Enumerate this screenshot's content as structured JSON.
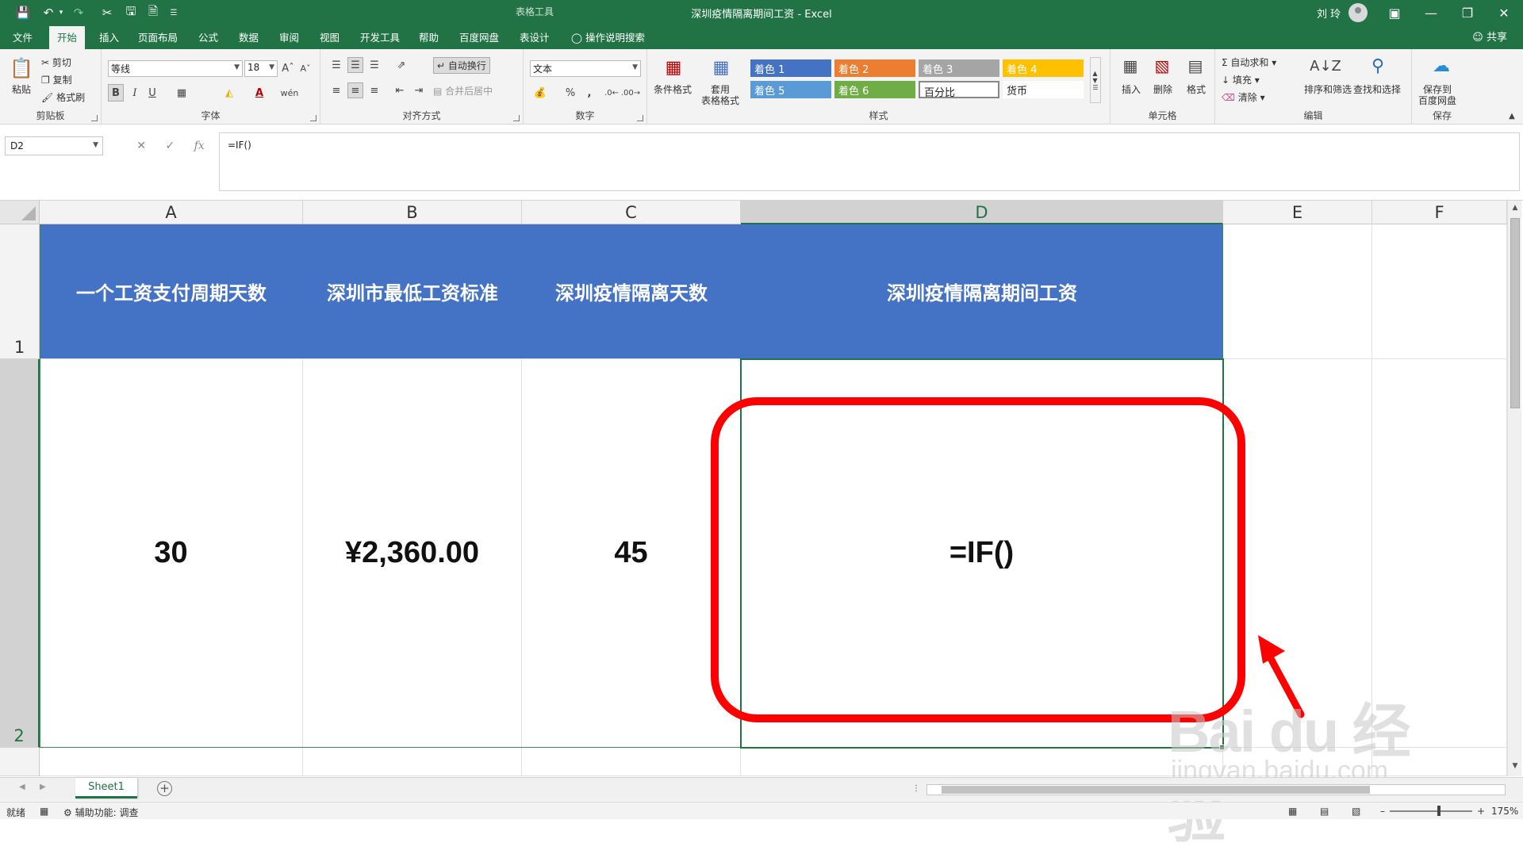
{
  "window": {
    "title": "深圳疫情隔离期间工资  -  Excel",
    "context_tool": "表格工具",
    "user_name": "刘 玲"
  },
  "tabs": [
    {
      "id": "file",
      "label": "文件"
    },
    {
      "id": "home",
      "label": "开始"
    },
    {
      "id": "insert",
      "label": "插入"
    },
    {
      "id": "page-layout",
      "label": "页面布局"
    },
    {
      "id": "formulas",
      "label": "公式"
    },
    {
      "id": "data",
      "label": "数据"
    },
    {
      "id": "review",
      "label": "审阅"
    },
    {
      "id": "view",
      "label": "视图"
    },
    {
      "id": "developer",
      "label": "开发工具"
    },
    {
      "id": "help",
      "label": "帮助"
    },
    {
      "id": "baidu",
      "label": "百度网盘"
    },
    {
      "id": "table-design",
      "label": "表设计"
    }
  ],
  "tell_me": "操作说明搜索",
  "share_label": "共享",
  "ribbon": {
    "clipboard": {
      "label": "剪贴板",
      "paste": "粘贴",
      "cut": "剪切",
      "copy": "复制",
      "format_painter": "格式刷"
    },
    "font": {
      "label": "字体",
      "font_name": "等线",
      "font_size": "18"
    },
    "alignment": {
      "label": "对齐方式",
      "wrap_text": "自动换行",
      "merge_center": "合并后居中"
    },
    "number": {
      "label": "数字",
      "format": "文本"
    },
    "styles": {
      "label": "样式",
      "conditional_formatting": "条件格式",
      "format_as_table": [
        "套用",
        "表格格式"
      ],
      "cells": [
        {
          "name": "着色 1",
          "color": "#4472c4"
        },
        {
          "name": "着色 2",
          "color": "#ed7d31"
        },
        {
          "name": "着色 3",
          "color": "#a5a5a5"
        },
        {
          "name": "着色 4",
          "color": "#ffc000"
        },
        {
          "name": "着色 5",
          "color": "#5b9bd5"
        },
        {
          "name": "着色 6",
          "color": "#70ad47"
        },
        {
          "name": "百分比",
          "color": "#ffffff"
        },
        {
          "name": "货币",
          "color": "#ffffff"
        }
      ]
    },
    "cells_group": {
      "label": "单元格",
      "insert": "插入",
      "delete": "删除",
      "format": "格式"
    },
    "editing": {
      "label": "编辑",
      "autosum": "自动求和",
      "fill": "填充",
      "clear": "清除",
      "sort_filter": "排序和筛选",
      "find_select": "查找和选择"
    },
    "save": {
      "label": "保存",
      "save_to_baidu": [
        "保存到",
        "百度网盘"
      ]
    }
  },
  "formula_bar": {
    "name_box": "D2",
    "formula": "=IF()"
  },
  "columns": [
    "A",
    "B",
    "C",
    "D",
    "E",
    "F"
  ],
  "rows": [
    "1",
    "2"
  ],
  "table": {
    "headers": [
      "一个工资支付周期天数",
      "深圳市最低工资标准",
      "深圳疫情隔离天数",
      "深圳疫情隔离期间工资"
    ],
    "values": [
      "30",
      "¥2,360.00",
      "45",
      "=IF()"
    ]
  },
  "watermark": {
    "logo": "Bai du 经验",
    "url": "jingyan.baidu.com"
  },
  "sheets": [
    "Sheet1"
  ],
  "status": {
    "ready": "就绪",
    "accessibility": "辅助功能: 调查",
    "zoom": "175%"
  },
  "colors": {
    "excel_green": "#217346",
    "header_fill": "#4472c4",
    "annotation": "#ff0000"
  }
}
